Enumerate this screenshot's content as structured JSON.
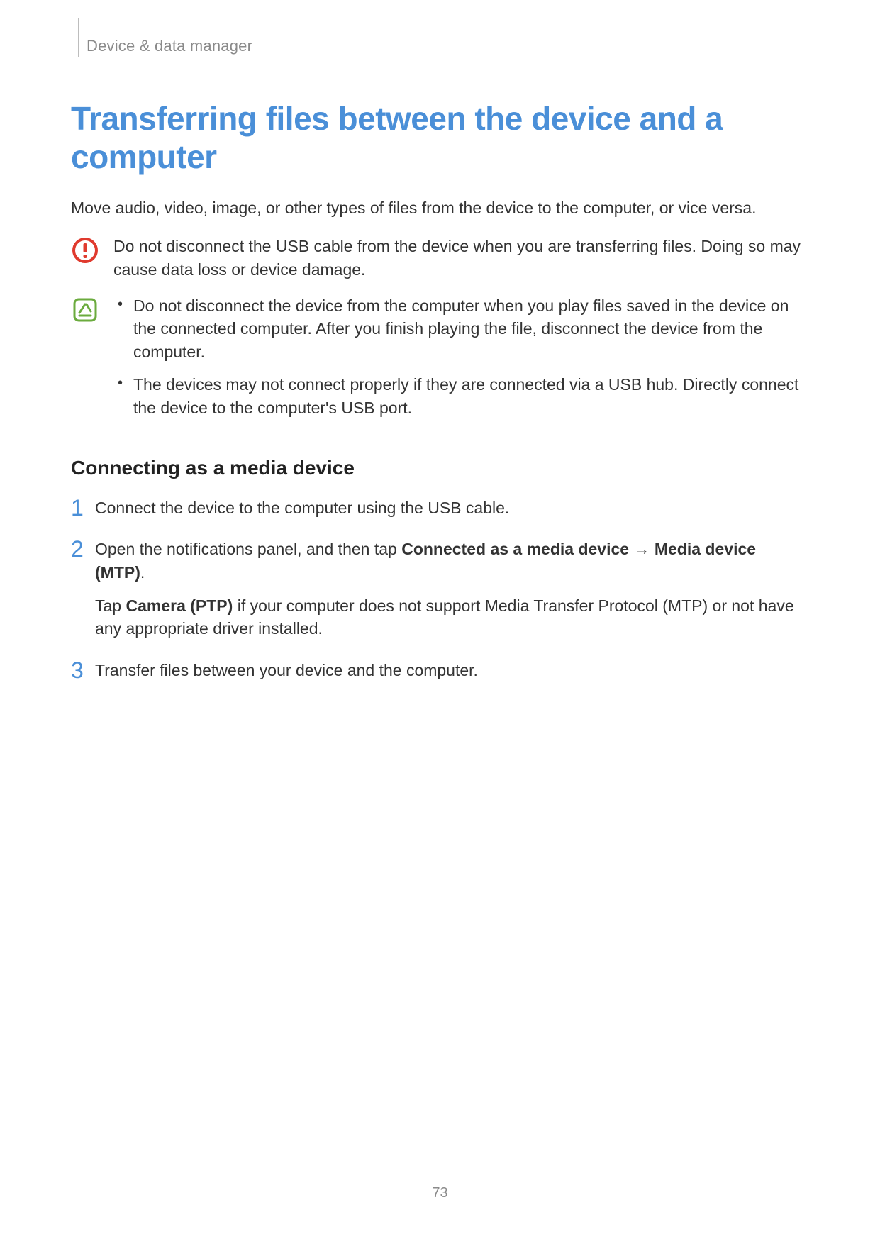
{
  "header": {
    "breadcrumb": "Device & data manager"
  },
  "title": "Transferring files between the device and a computer",
  "intro": "Move audio, video, image, or other types of files from the device to the computer, or vice versa.",
  "caution": {
    "icon": "caution-icon",
    "text": "Do not disconnect the USB cable from the device when you are transferring files. Doing so may cause data loss or device damage."
  },
  "note": {
    "icon": "note-icon",
    "bullets": [
      "Do not disconnect the device from the computer when you play files saved in the device on the connected computer. After you finish playing the file, disconnect the device from the computer.",
      "The devices may not connect properly if they are connected via a USB hub. Directly connect the device to the computer's USB port."
    ]
  },
  "subheading": "Connecting as a media device",
  "steps": [
    {
      "num": "1",
      "paragraphs": [
        {
          "runs": [
            {
              "text": "Connect the device to the computer using the USB cable."
            }
          ]
        }
      ]
    },
    {
      "num": "2",
      "paragraphs": [
        {
          "runs": [
            {
              "text": "Open the notifications panel, and then tap "
            },
            {
              "text": "Connected as a media device",
              "bold": true
            },
            {
              "text": " → ",
              "arrow": true
            },
            {
              "text": "Media device (MTP)",
              "bold": true
            },
            {
              "text": "."
            }
          ]
        },
        {
          "runs": [
            {
              "text": "Tap "
            },
            {
              "text": "Camera (PTP)",
              "bold": true
            },
            {
              "text": " if your computer does not support Media Transfer Protocol (MTP) or not have any appropriate driver installed."
            }
          ]
        }
      ]
    },
    {
      "num": "3",
      "paragraphs": [
        {
          "runs": [
            {
              "text": "Transfer files between your device and the computer."
            }
          ]
        }
      ]
    }
  ],
  "page_number": "73"
}
